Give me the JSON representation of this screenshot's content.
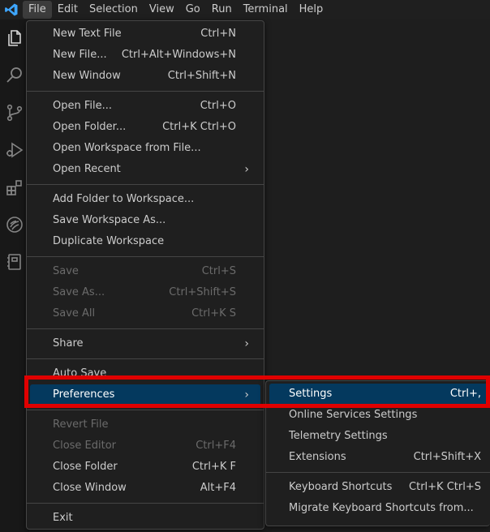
{
  "menubar": [
    "File",
    "Edit",
    "Selection",
    "View",
    "Go",
    "Run",
    "Terminal",
    "Help"
  ],
  "file_menu": {
    "groups": [
      [
        {
          "label": "New Text File",
          "shortcut": "Ctrl+N"
        },
        {
          "label": "New File...",
          "shortcut": "Ctrl+Alt+Windows+N"
        },
        {
          "label": "New Window",
          "shortcut": "Ctrl+Shift+N"
        }
      ],
      [
        {
          "label": "Open File...",
          "shortcut": "Ctrl+O"
        },
        {
          "label": "Open Folder...",
          "shortcut": "Ctrl+K Ctrl+O"
        },
        {
          "label": "Open Workspace from File...",
          "shortcut": ""
        },
        {
          "label": "Open Recent",
          "shortcut": "",
          "submenu": true
        }
      ],
      [
        {
          "label": "Add Folder to Workspace...",
          "shortcut": ""
        },
        {
          "label": "Save Workspace As...",
          "shortcut": ""
        },
        {
          "label": "Duplicate Workspace",
          "shortcut": ""
        }
      ],
      [
        {
          "label": "Save",
          "shortcut": "Ctrl+S",
          "disabled": true
        },
        {
          "label": "Save As...",
          "shortcut": "Ctrl+Shift+S",
          "disabled": true
        },
        {
          "label": "Save All",
          "shortcut": "Ctrl+K S",
          "disabled": true
        }
      ],
      [
        {
          "label": "Share",
          "shortcut": "",
          "submenu": true
        }
      ],
      [
        {
          "label": "Auto Save",
          "shortcut": ""
        },
        {
          "label": "Preferences",
          "shortcut": "",
          "submenu": true,
          "highlight": true
        }
      ],
      [
        {
          "label": "Revert File",
          "shortcut": "",
          "disabled": true
        },
        {
          "label": "Close Editor",
          "shortcut": "Ctrl+F4",
          "disabled": true
        },
        {
          "label": "Close Folder",
          "shortcut": "Ctrl+K F"
        },
        {
          "label": "Close Window",
          "shortcut": "Alt+F4"
        }
      ],
      [
        {
          "label": "Exit",
          "shortcut": ""
        }
      ]
    ]
  },
  "preferences_menu": {
    "groups": [
      [
        {
          "label": "Settings",
          "shortcut": "Ctrl+,",
          "highlight": true
        },
        {
          "label": "Online Services Settings",
          "shortcut": ""
        },
        {
          "label": "Telemetry Settings",
          "shortcut": ""
        },
        {
          "label": "Extensions",
          "shortcut": "Ctrl+Shift+X"
        }
      ],
      [
        {
          "label": "Keyboard Shortcuts",
          "shortcut": "Ctrl+K Ctrl+S"
        },
        {
          "label": "Migrate Keyboard Shortcuts from...",
          "shortcut": ""
        }
      ]
    ]
  },
  "activity_icons": [
    "explorer-icon",
    "search-icon",
    "source-control-icon",
    "run-debug-icon",
    "extensions-icon",
    "remote-icon",
    "notebook-icon"
  ],
  "colors": {
    "accent_highlight": "#04395e",
    "annotation_red": "#e00000",
    "logo_blue": "#3ea6ff"
  }
}
